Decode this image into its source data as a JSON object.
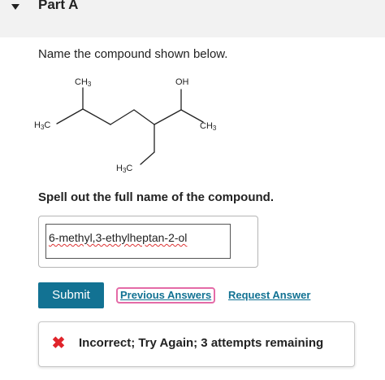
{
  "part": {
    "title": "Part A"
  },
  "question": {
    "text": "Name the compound shown below."
  },
  "structure": {
    "labels": {
      "ch3_top": "CH3",
      "oh": "OH",
      "h3c_left": "H3C",
      "ch3_right": "CH3",
      "h3c_bottom": "H3C"
    }
  },
  "instruction": {
    "text": "Spell out the full name of the compound."
  },
  "answer": {
    "value": "6-methyl,3-ethylheptan-2-ol"
  },
  "actions": {
    "submit_label": "Submit",
    "previous_answers_label": "Previous Answers",
    "request_answer_label": "Request Answer"
  },
  "feedback": {
    "icon": "x-icon",
    "text": "Incorrect; Try Again; 3 attempts remaining",
    "color": "#e0242b"
  },
  "colors": {
    "accent": "#127293",
    "highlight_border": "#e46ba7",
    "header_bg": "#f2f2f2"
  }
}
